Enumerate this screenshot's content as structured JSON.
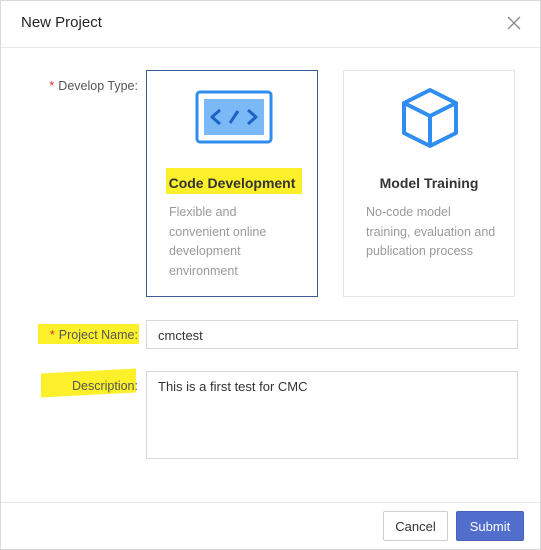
{
  "dialog": {
    "title": "New Project"
  },
  "form": {
    "develop_type_label": "Develop Type",
    "project_name_label": "Project Name",
    "description_label": "Description",
    "required_mark": "*",
    "label_colon": ":"
  },
  "cards": [
    {
      "title": "Code Development",
      "desc": "Flexible and convenient online development environment",
      "icon": "code-icon",
      "selected": true
    },
    {
      "title": "Model Training",
      "desc": "No-code model training, evaluation and publication process",
      "icon": "cube-icon",
      "selected": false
    }
  ],
  "fields": {
    "project_name_value": "cmctest",
    "description_value": "This is a first test for CMC"
  },
  "buttons": {
    "cancel": "Cancel",
    "submit": "Submit"
  },
  "colors": {
    "accent": "#526ecc",
    "icon_blue": "#2f8cf0",
    "highlight": "#fbf02a",
    "required": "#e0301e"
  }
}
